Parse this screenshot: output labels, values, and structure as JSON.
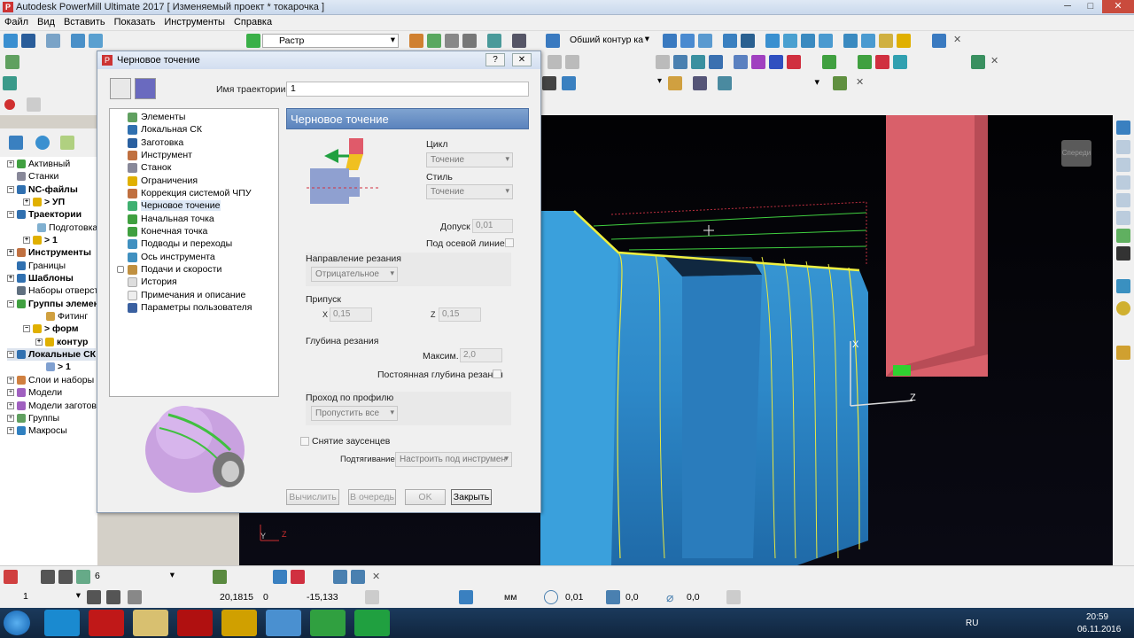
{
  "window": {
    "title": "Autodesk PowerMill Ultimate 2017   [ Изменяемый проект * токарочка ]"
  },
  "menu": [
    "Файл",
    "Вид",
    "Вставить",
    "Показать",
    "Инструменты",
    "Справка"
  ],
  "toolbar": {
    "raster_label": "Растр",
    "contour_label": "Обший контур ка"
  },
  "explorer": {
    "items": [
      {
        "label": "Активный",
        "bold": false
      },
      {
        "label": "Станки",
        "bold": false
      },
      {
        "label": "NC-файлы",
        "bold": true
      },
      {
        "label": "> УП",
        "bold": true
      },
      {
        "label": "Траектории",
        "bold": true
      },
      {
        "label": "Подготовка",
        "bold": false
      },
      {
        "label": "> 1",
        "bold": true
      },
      {
        "label": "Инструменты",
        "bold": true
      },
      {
        "label": "Границы",
        "bold": false
      },
      {
        "label": "Шаблоны",
        "bold": true
      },
      {
        "label": "Наборы отверст",
        "bold": false
      },
      {
        "label": "Группы элемен",
        "bold": true
      },
      {
        "label": "Фитинг",
        "bold": false
      },
      {
        "label": "> форм",
        "bold": true
      },
      {
        "label": "контур",
        "bold": true
      },
      {
        "label": "Локальные СК",
        "bold": true
      },
      {
        "label": "> 1",
        "bold": true
      },
      {
        "label": "Слои и наборы",
        "bold": false
      },
      {
        "label": "Модели",
        "bold": false
      },
      {
        "label": "Модели заготов",
        "bold": false
      },
      {
        "label": "Группы",
        "bold": false
      },
      {
        "label": "Макросы",
        "bold": false
      }
    ]
  },
  "dialog": {
    "title": "Черновое точение",
    "help": "?",
    "close": "✕",
    "name_label": "Имя траектории",
    "name_value": "1",
    "tree": [
      "Элементы",
      "Локальная СК",
      "Заготовка",
      "Инструмент",
      "Станок",
      "Ограничения",
      "Коррекция системой ЧПУ",
      "Черновое точение",
      "Начальная точка",
      "Конечная точка",
      "Подводы и переходы",
      "Ось инструмента",
      "Подачи и скорости",
      "История",
      "Примечания и описание",
      "Параметры пользователя"
    ],
    "panel_title": "Черновое точение",
    "cycle_label": "Цикл",
    "cycle_value": "Точение",
    "style_label": "Стиль",
    "style_value": "Точение",
    "tolerance_label": "Допуск",
    "tolerance_value": "0,01",
    "below_axis_label": "Под осевой линией",
    "cut_dir_label": "Направление резания",
    "cut_dir_value": "Отрицательное",
    "allowance_label": "Припуск",
    "x_label": "X",
    "x_value": "0,15",
    "z_label": "Z",
    "z_value": "0,15",
    "depth_label": "Глубина резания",
    "max_label": "Максим.",
    "max_value": "2,0",
    "const_depth_label": "Постоянная глубина резания",
    "profile_label": "Проход по профилю",
    "profile_value": "Пропустить все",
    "deburr_label": "Снятие заусенцев",
    "retract_label": "Подтягивание",
    "retract_value": "Настроить под инструмен",
    "buttons": {
      "calc": "Вычислить",
      "queue": "В очередь",
      "ok": "OK",
      "close": "Закрыть"
    }
  },
  "viewport": {
    "view_cube": "Спереди",
    "axis_x": "X",
    "axis_z": "Z",
    "mini_y": "Y",
    "mini_z": "Z"
  },
  "status": {
    "tol_value": "6",
    "coord_x": "20,1815",
    "coord_y": "0",
    "coord_z": "-15,133",
    "units": "мм",
    "step1": "0,01",
    "step2": "0,0",
    "step3": "0,0",
    "layer": "1"
  },
  "taskbar": {
    "lang": "RU",
    "time": "20:59",
    "date": "06.11.2016"
  }
}
